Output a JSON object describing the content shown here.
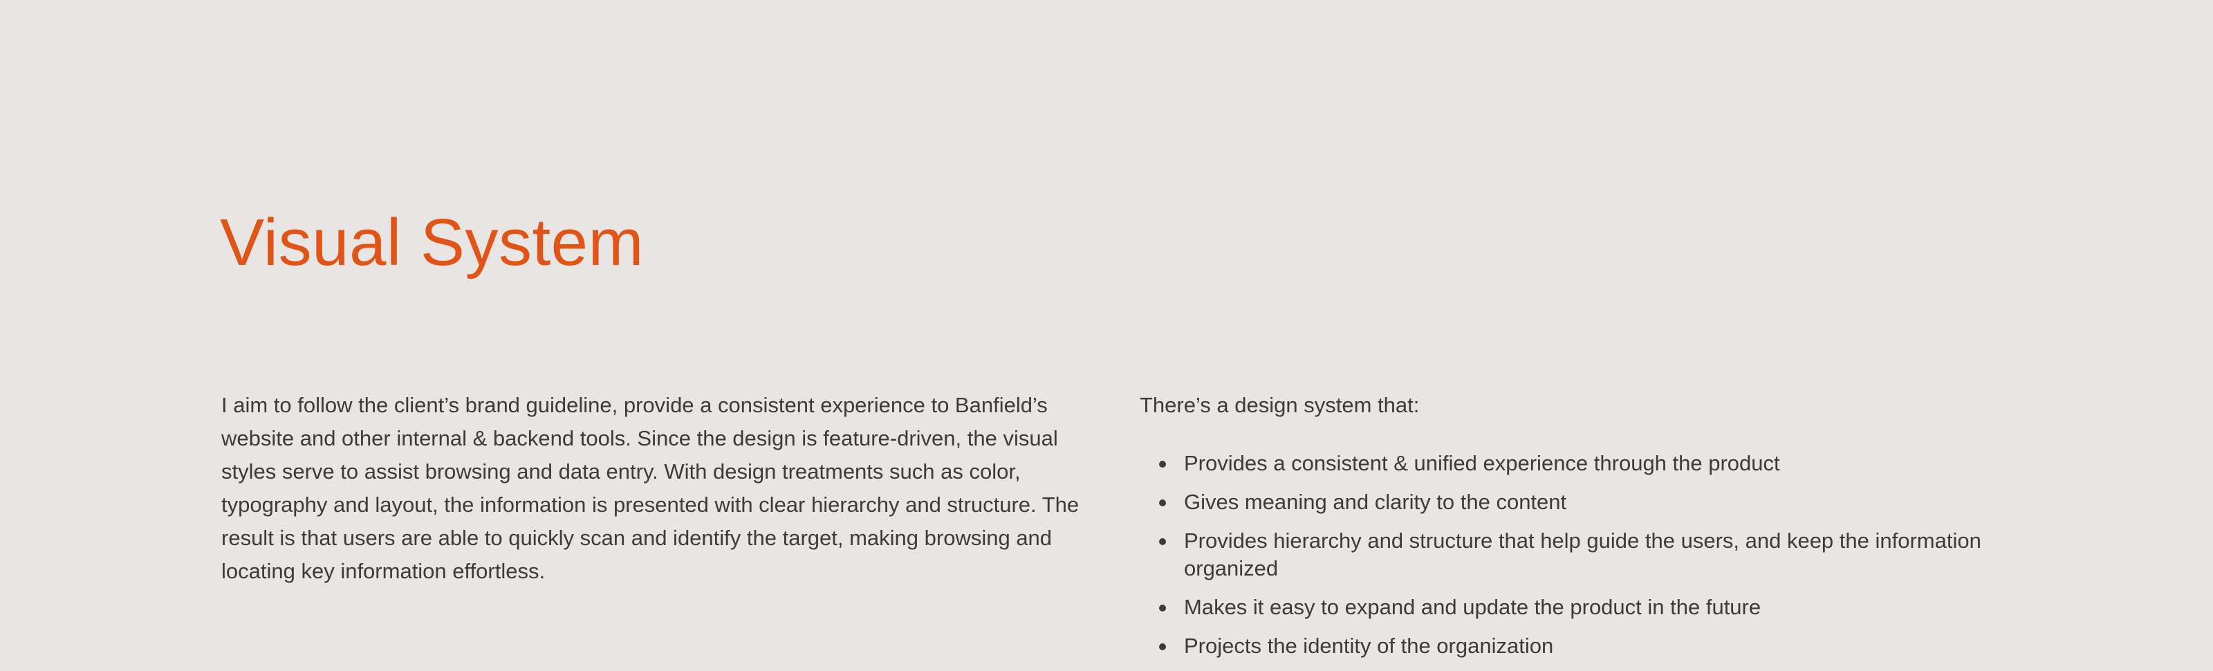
{
  "section": {
    "title": "Visual System",
    "accent_color": "#e25416",
    "background_color": "#e8e6e4"
  },
  "intro": {
    "text": "I aim to follow the client’s brand guideline, provide a consistent experience to Banfield’s website and other internal & backend tools. Since the design is feature-driven, the visual styles serve to assist browsing and data entry. With design treatments such as color, typography and layout, the information is presented with clear hierarchy and structure. The result is that users are able to quickly scan and identify the target, making browsing and locating key information effortless."
  },
  "design_system": {
    "lead": "There’s a design system that:",
    "items": [
      {
        "text": "Provides a consistent & unified experience through the product"
      },
      {
        "text": "Gives meaning and clarity to the content"
      },
      {
        "text": "Provides hierarchy and structure that help guide the users, and keep the information organized"
      },
      {
        "text": "Makes it easy to expand and update the product in the future"
      },
      {
        "text": "Projects the identity of the organization"
      }
    ]
  }
}
